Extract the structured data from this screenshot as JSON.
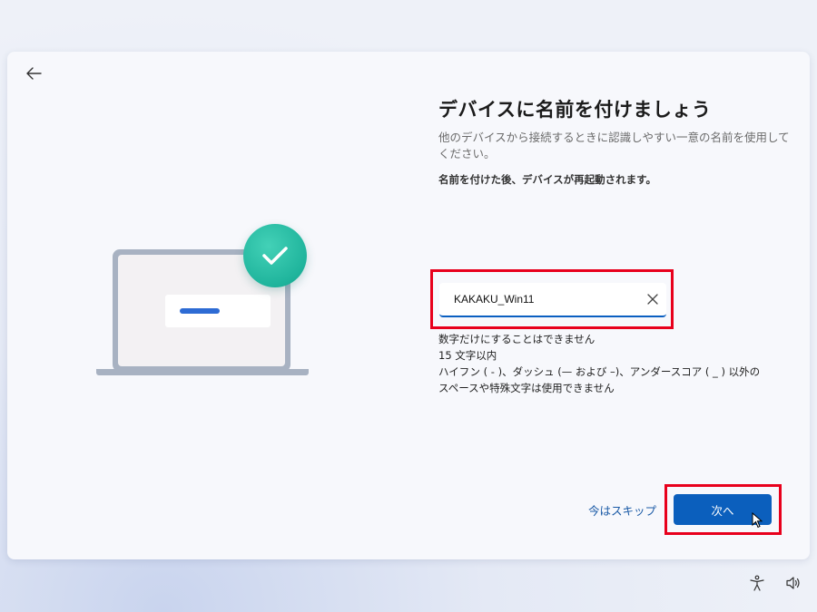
{
  "page": {
    "title": "デバイスに名前を付けましょう",
    "subtitle": "他のデバイスから接続するときに認識しやすい一意の名前を使用してください。",
    "notice": "名前を付けた後、デバイスが再起動されます。"
  },
  "device_name_input": {
    "value": "KAKAKU_Win11",
    "clear_icon": "close-icon"
  },
  "rules": [
    "数字だけにすることはできません",
    "15 文字以内",
    "ハイフン ( - )、ダッシュ (— および –)、アンダースコア ( _ ) 以外の",
    "スペースや特殊文字は使用できません"
  ],
  "actions": {
    "skip_label": "今はスキップ",
    "next_label": "次へ"
  },
  "icons": {
    "back": "back-arrow-icon",
    "check": "checkmark-icon",
    "accessibility": "accessibility-icon",
    "volume": "volume-icon"
  },
  "colors": {
    "accent": "#0b5fbd",
    "highlight": "#e8001c",
    "check_badge": "#1fb49c"
  }
}
